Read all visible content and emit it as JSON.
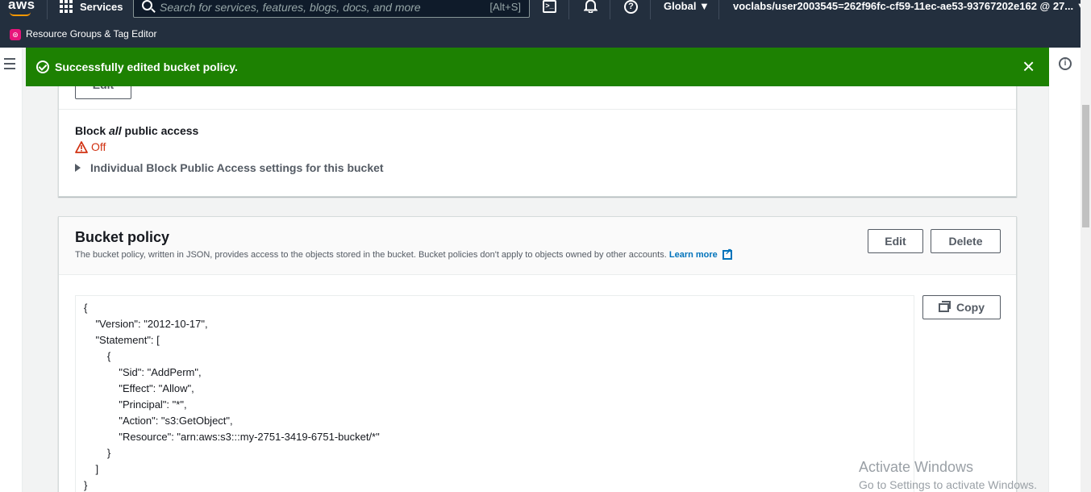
{
  "topnav": {
    "logo": "aws",
    "services_label": "Services",
    "search_placeholder": "Search for services, features, blogs, docs, and more",
    "search_shortcut": "[Alt+S]",
    "region": "Global ▼",
    "account": "voclabs/user2003545=262f96fc-cf59-11ec-ae53-93767202e162 @ 27... ▼"
  },
  "subnav": {
    "label": "Resource Groups & Tag Editor"
  },
  "flash": {
    "message": "Successfully edited bucket policy.",
    "type": "success",
    "color": "#1d8102"
  },
  "block_public_access": {
    "edit_label": "Edit",
    "label_prefix": "Block ",
    "label_em": "all",
    "label_suffix": " public access",
    "status": "Off",
    "expander": "Individual Block Public Access settings for this bucket"
  },
  "bucket_policy": {
    "title": "Bucket policy",
    "description": "The bucket policy, written in JSON, provides access to the objects stored in the bucket. Bucket policies don't apply to objects owned by other accounts.",
    "learn_more": "Learn more",
    "edit_label": "Edit",
    "delete_label": "Delete",
    "copy_label": "Copy",
    "code_lines": [
      "{",
      "    \"Version\": \"2012-10-17\",",
      "    \"Statement\": [",
      "        {",
      "            \"Sid\": \"AddPerm\",",
      "            \"Effect\": \"Allow\",",
      "            \"Principal\": \"*\",",
      "            \"Action\": \"s3:GetObject\",",
      "            \"Resource\": \"arn:aws:s3:::my-2751-3419-6751-bucket/*\"",
      "        }",
      "    ]",
      "}"
    ]
  },
  "watermark": {
    "line1": "Activate Windows",
    "line2": "Go to Settings to activate Windows."
  }
}
